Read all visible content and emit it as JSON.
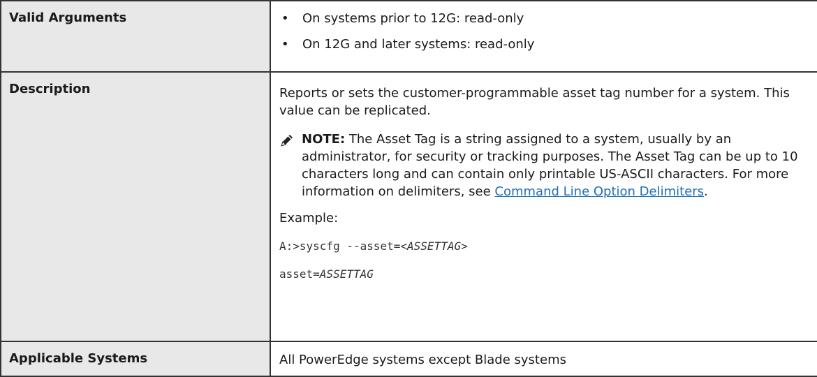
{
  "rows": {
    "valid_arguments": {
      "label": "Valid Arguments",
      "items": [
        "On systems prior to 12G: read-only",
        "On 12G and later systems: read-only"
      ]
    },
    "description": {
      "label": "Description",
      "text": "Reports or sets the customer-programmable asset tag number for a system. This value can be replicated.",
      "note": {
        "icon": "pencil-note-icon",
        "label": "NOTE:",
        "text": " The Asset Tag is a string assigned to a system, usually by an administrator, for security or tracking purposes. The Asset Tag can be up to 10 characters long and can contain only printable US-ASCII characters. For more information on delimiters, see ",
        "link": "Command Line Option Delimiters",
        "suffix": "."
      },
      "example_label": "Example:",
      "code1_prefix": "A:>syscfg --asset=<",
      "code1_var": "ASSETTAG",
      "code1_suffix": ">",
      "code2_prefix": "asset=",
      "code2_var": "ASSETTAG"
    },
    "applicable_systems": {
      "label": "Applicable Systems",
      "text": "All PowerEdge systems except Blade systems"
    }
  },
  "colors": {
    "header_bg": "#e8e8e8",
    "border": "#333333",
    "link": "#1f6fb5"
  }
}
